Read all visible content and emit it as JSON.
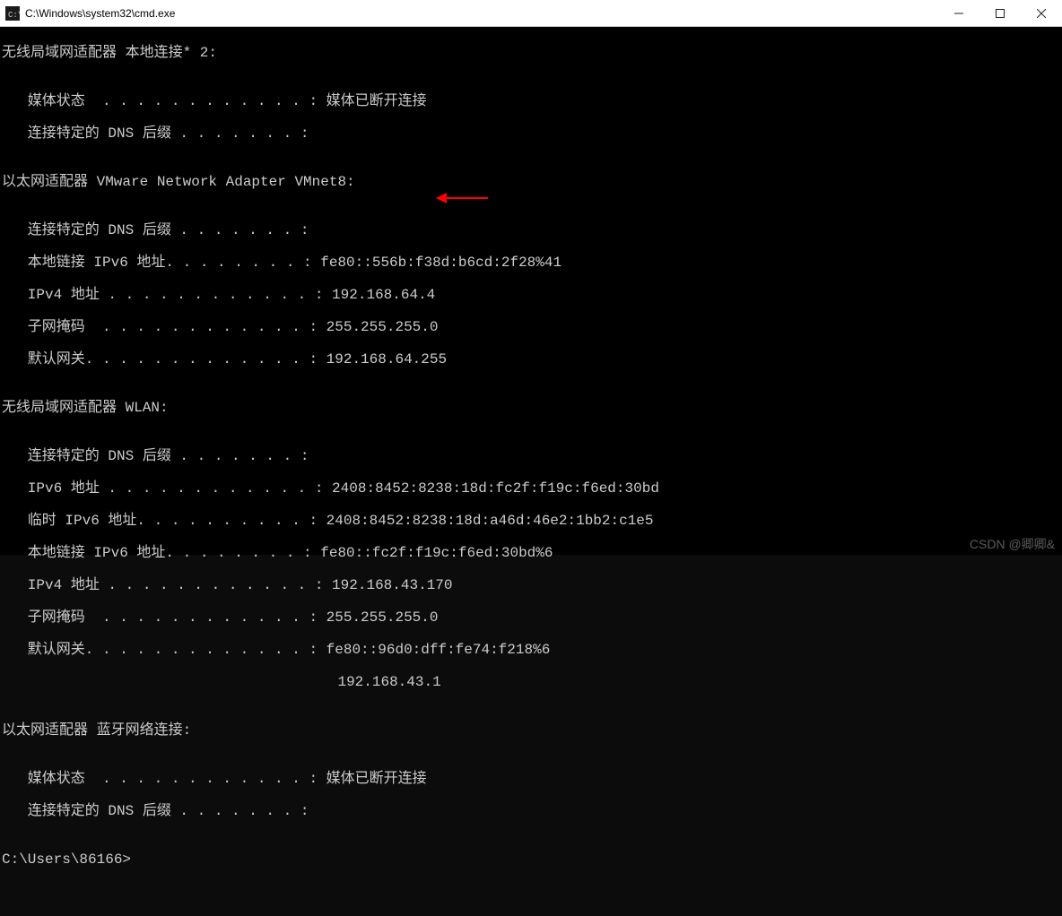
{
  "window": {
    "title": "C:\\Windows\\system32\\cmd.exe"
  },
  "lines": {
    "l0": "无线局域网适配器 本地连接* 2:",
    "l1": "",
    "l2": "   媒体状态  . . . . . . . . . . . . : 媒体已断开连接",
    "l3": "   连接特定的 DNS 后缀 . . . . . . . :",
    "l4": "",
    "l5": "以太网适配器 VMware Network Adapter VMnet8:",
    "l6": "",
    "l7": "   连接特定的 DNS 后缀 . . . . . . . :",
    "l8": "   本地链接 IPv6 地址. . . . . . . . : fe80::556b:f38d:b6cd:2f28%41",
    "l9": "   IPv4 地址 . . . . . . . . . . . . : 192.168.64.4",
    "l10": "   子网掩码  . . . . . . . . . . . . : 255.255.255.0",
    "l11": "   默认网关. . . . . . . . . . . . . : 192.168.64.255",
    "l12": "",
    "l13": "无线局域网适配器 WLAN:",
    "l14": "",
    "l15": "   连接特定的 DNS 后缀 . . . . . . . :",
    "l16": "   IPv6 地址 . . . . . . . . . . . . : 2408:8452:8238:18d:fc2f:f19c:f6ed:30bd",
    "l17": "   临时 IPv6 地址. . . . . . . . . . : 2408:8452:8238:18d:a46d:46e2:1bb2:c1e5",
    "l18": "   本地链接 IPv6 地址. . . . . . . . : fe80::fc2f:f19c:f6ed:30bd%6",
    "l19": "   IPv4 地址 . . . . . . . . . . . . : 192.168.43.170",
    "l20": "   子网掩码  . . . . . . . . . . . . : 255.255.255.0",
    "l21": "   默认网关. . . . . . . . . . . . . : fe80::96d0:dff:fe74:f218%6",
    "l22": "                                       192.168.43.1",
    "l23": "",
    "l24": "以太网适配器 蓝牙网络连接:",
    "l25": "",
    "l26": "   媒体状态  . . . . . . . . . . . . : 媒体已断开连接",
    "l27": "   连接特定的 DNS 后缀 . . . . . . . :",
    "l28": "",
    "l29": "C:\\Users\\86166>"
  },
  "annotation": {
    "arrow_target": "192.168.64.4",
    "arrow_color": "#ff0000"
  },
  "watermark": "CSDN @卿卿&"
}
